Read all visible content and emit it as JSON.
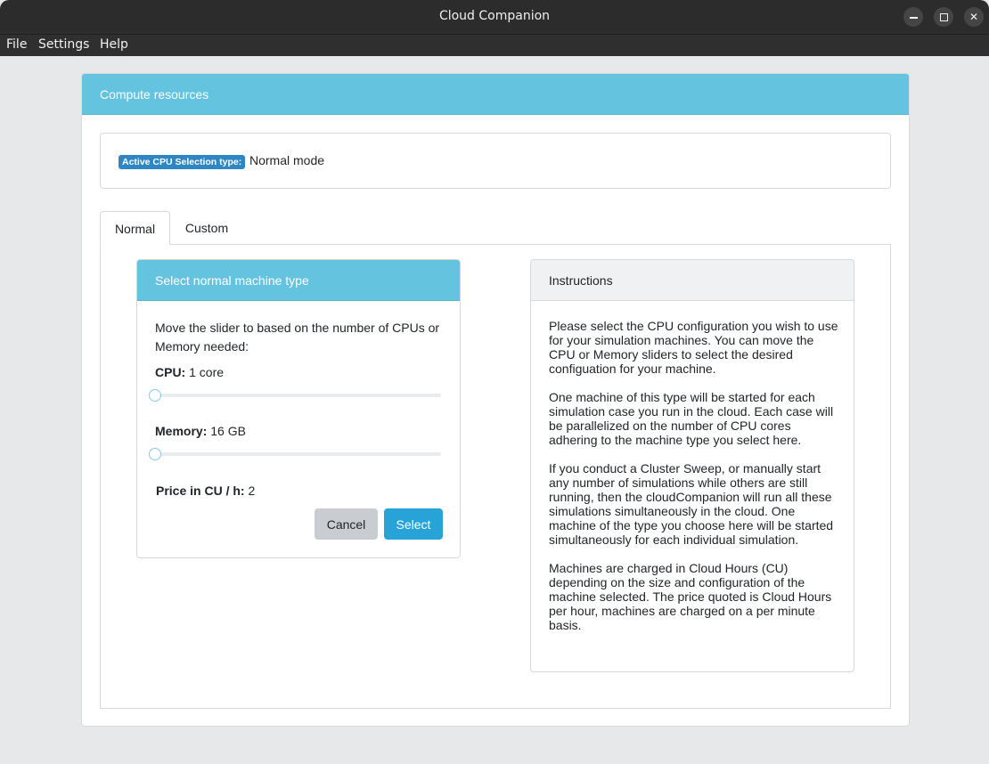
{
  "window": {
    "title": "Cloud Companion",
    "controls": [
      "minimize",
      "maximize",
      "close"
    ],
    "close_glyph": "✕"
  },
  "menu": [
    "File",
    "Settings",
    "Help"
  ],
  "card": {
    "title": "Compute resources",
    "status": {
      "badge": "Active CPU Selection type:",
      "value": "Normal mode"
    },
    "tabs": [
      {
        "label": "Normal",
        "active": true
      },
      {
        "label": "Custom",
        "active": false
      }
    ]
  },
  "normal_panel": {
    "title": "Select normal machine type",
    "description": "Move the slider to based on the number of CPUs or Memory needed:",
    "cpu": {
      "label": "CPU:",
      "value": "1 core",
      "slider_fraction": 0
    },
    "memory": {
      "label": "Memory:",
      "value": "16 GB",
      "slider_fraction": 0
    },
    "price": {
      "label": "Price in CU / h:",
      "value": "2"
    },
    "buttons": {
      "cancel": "Cancel",
      "select": "Select"
    }
  },
  "instructions": {
    "title": "Instructions",
    "paragraphs": [
      "Please select the CPU configuration you wish to use for your simulation machines. You can move the CPU or Memory sliders to select the desired configuation for your machine.",
      "One machine of this type will be started for each simulation case you run in the cloud. Each case will be parallelized on the number of CPU cores adhering to the machine type you select here.",
      "If you conduct a Cluster Sweep, or manually start any number of simulations while others are still running, then the cloudCompanion will run all these simulations simultaneously in the cloud. One machine of the type you choose here will be started simultaneously for each individual simulation.",
      "Machines are charged in Cloud Hours (CU) depending on the size and configuration of the machine selected. The price quoted is Cloud Hours per hour, machines are charged on a per minute basis."
    ]
  },
  "colors": {
    "header_accent": "#64c3df",
    "badge": "#2f86c4",
    "primary_button": "#28a3d8",
    "secondary_button": "#c9cdd1"
  }
}
